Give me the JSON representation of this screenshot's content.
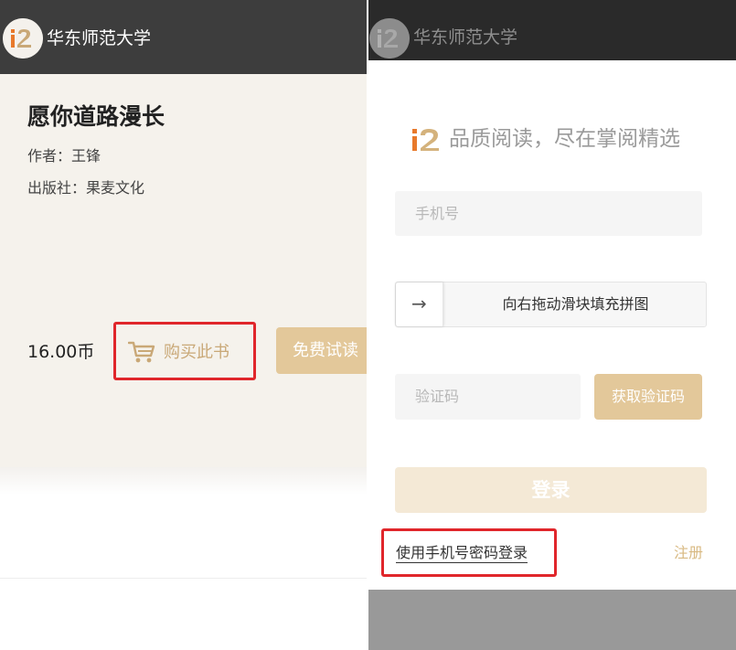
{
  "left": {
    "header": {
      "title": "华东师范大学",
      "logo_text": "i2"
    },
    "book": {
      "title": "愿你道路漫长",
      "author": "作者：王锋",
      "publisher": "出版社：果麦文化",
      "price": "16.00币"
    },
    "buy_button": {
      "label": "购买此书",
      "icon": "cart-icon"
    },
    "trial_button": {
      "label": "免费试读"
    }
  },
  "right": {
    "header": {
      "title": "华东师范大学",
      "logo_text": "i2"
    },
    "slogan": "品质阅读，尽在掌阅精选",
    "phone_input": {
      "placeholder": "手机号"
    },
    "slider": {
      "text": "向右拖动滑块填充拼图",
      "handle_icon": "arrow-right-icon",
      "handle_glyph": "→"
    },
    "code_input": {
      "placeholder": "验证码"
    },
    "get_code_button": {
      "label": "获取验证码"
    },
    "login_button": {
      "label": "登录"
    },
    "password_login_link": "使用手机号密码登录",
    "register_link": "注册"
  },
  "colors": {
    "accent_gold": "#e3c89a",
    "accent_gold_text": "#c9a877",
    "header_dark": "#3d3d3d",
    "highlight_red": "#e0262b",
    "book_bg": "#f5f2ec"
  }
}
